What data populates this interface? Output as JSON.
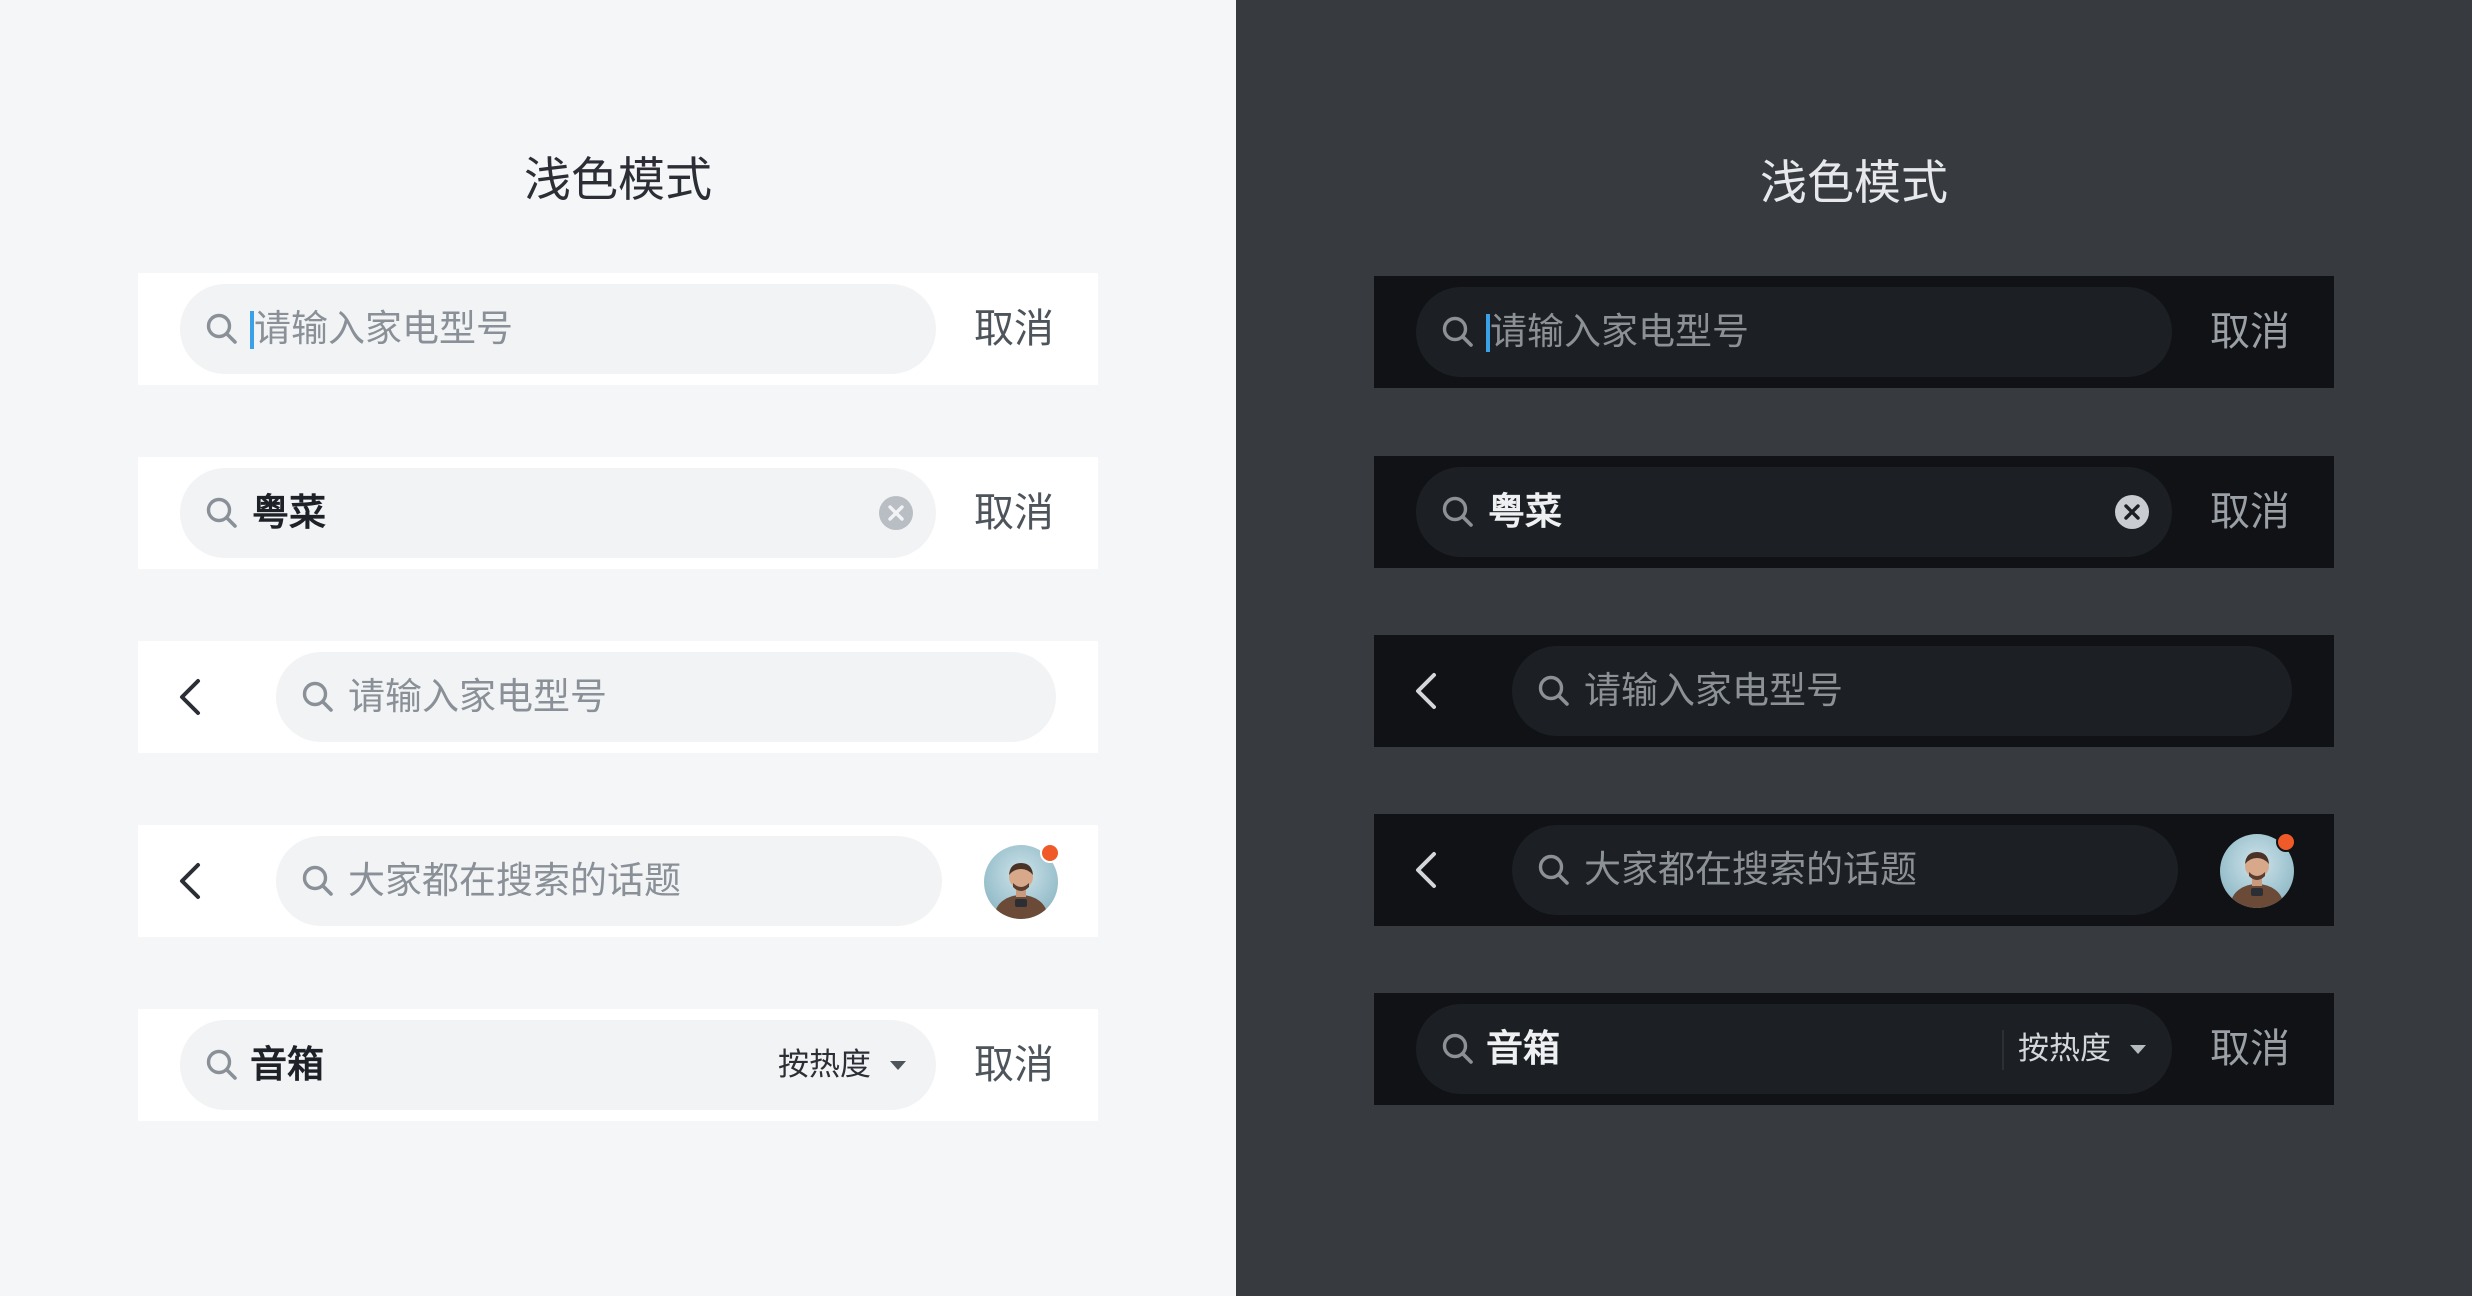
{
  "colors": {
    "light_bg": "#f4f6f8",
    "dark_bg": "#373a3f",
    "accent_caret": "#3aa0e8",
    "badge": "#f05a28"
  },
  "light": {
    "title": "浅色模式",
    "row1": {
      "placeholder": "请输入家电型号",
      "cancel": "取消",
      "icon": "search-icon"
    },
    "row2": {
      "value": "粤菜",
      "cancel": "取消",
      "clear_icon": "clear-icon"
    },
    "row3": {
      "placeholder": "请输入家电型号",
      "back_icon": "chevron-left-icon"
    },
    "row4": {
      "placeholder": "大家都在搜索的话题",
      "back_icon": "chevron-left-icon",
      "avatar": "avatar"
    },
    "row5": {
      "value": "音箱",
      "sort": "按热度",
      "cancel": "取消"
    }
  },
  "dark": {
    "title": "浅色模式",
    "row1": {
      "placeholder": "请输入家电型号",
      "cancel": "取消",
      "icon": "search-icon"
    },
    "row2": {
      "value": "粤菜",
      "cancel": "取消",
      "clear_icon": "clear-icon"
    },
    "row3": {
      "placeholder": "请输入家电型号",
      "back_icon": "chevron-left-icon"
    },
    "row4": {
      "placeholder": "大家都在搜索的话题",
      "back_icon": "chevron-left-icon",
      "avatar": "avatar"
    },
    "row5": {
      "value": "音箱",
      "sort": "按热度",
      "cancel": "取消"
    }
  }
}
